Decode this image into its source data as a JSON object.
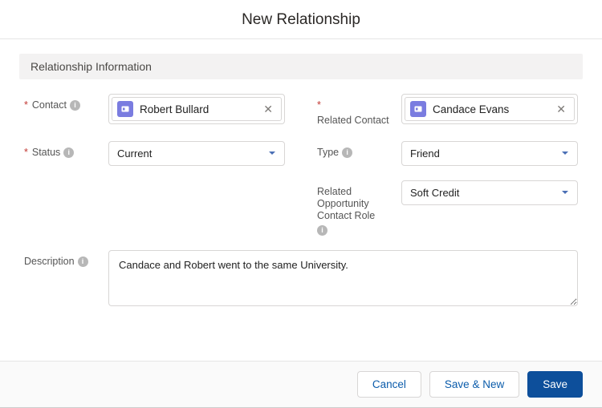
{
  "modal": {
    "title": "New Relationship"
  },
  "section": {
    "title": "Relationship Information"
  },
  "fields": {
    "contact": {
      "label": "Contact",
      "required": true,
      "pill": "Robert Bullard"
    },
    "related_contact": {
      "label": "Related Contact",
      "required": true,
      "pill": "Candace Evans"
    },
    "status": {
      "label": "Status",
      "required": true,
      "value": "Current"
    },
    "type": {
      "label": "Type",
      "value": "Friend"
    },
    "related_opp_role": {
      "label": "Related Opportunity Contact Role",
      "value": "Soft Credit"
    },
    "description": {
      "label": "Description",
      "value": "Candace and Robert went to the same University."
    }
  },
  "buttons": {
    "cancel": "Cancel",
    "save_new": "Save & New",
    "save": "Save"
  }
}
